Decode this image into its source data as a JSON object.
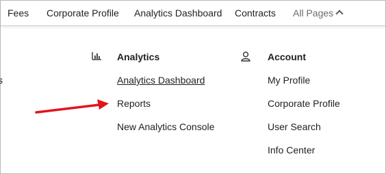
{
  "topnav": {
    "items": [
      {
        "label": "Fees"
      },
      {
        "label": "Corporate Profile"
      },
      {
        "label": "Analytics Dashboard"
      },
      {
        "label": "Contracts"
      },
      {
        "label": "All Pages"
      }
    ]
  },
  "dropdown": {
    "left_fragment": "s",
    "analytics": {
      "icon": "bar-chart-icon",
      "title": "Analytics",
      "links": [
        {
          "label": "Analytics Dashboard"
        },
        {
          "label": "Reports"
        },
        {
          "label": "New Analytics Console"
        }
      ]
    },
    "account": {
      "icon": "user-icon",
      "title": "Account",
      "links": [
        {
          "label": "My Profile"
        },
        {
          "label": "Corporate Profile"
        },
        {
          "label": "User Search"
        },
        {
          "label": "Info Center"
        }
      ]
    }
  },
  "annotation": {
    "arrow_color": "#e0141a",
    "points_to": "Reports"
  }
}
